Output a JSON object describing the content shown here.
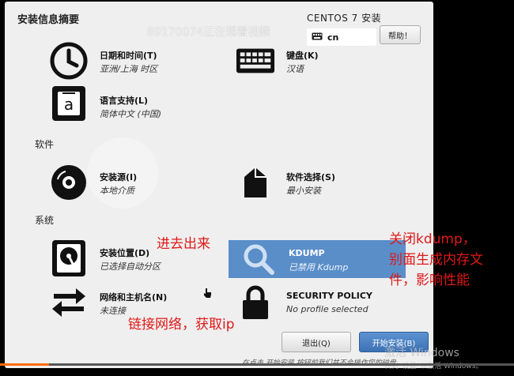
{
  "header": {
    "title": "安装信息摘要",
    "product": "CENTOS 7 安装",
    "keyboard_layout": "cn",
    "help_label": "帮助！"
  },
  "overlay": {
    "viewer_watermark": "89170074正在观看视频",
    "activate_windows_title": "激活 Windows",
    "activate_windows_sub": "转到“设置”以激活 Windows。"
  },
  "sections": {
    "software": "软件",
    "system": "系统"
  },
  "hubs": {
    "datetime": {
      "title": "日期和时间(T)",
      "status": "亚洲/上海 时区"
    },
    "keyboard": {
      "title": "键盘(K)",
      "status": "汉语"
    },
    "language": {
      "title": "语言支持(L)",
      "status": "简体中文 (中国)"
    },
    "source": {
      "title": "安装源(I)",
      "status": "本地介质"
    },
    "software_selection": {
      "title": "软件选择(S)",
      "status": "最小安装"
    },
    "destination": {
      "title": "安装位置(D)",
      "status": "已选择自动分区"
    },
    "kdump": {
      "title": "KDUMP",
      "status": "已禁用 Kdump"
    },
    "network": {
      "title": "网络和主机名(N)",
      "status": "未连接"
    },
    "security": {
      "title": "SECURITY POLICY",
      "status": "No profile selected"
    }
  },
  "buttons": {
    "quit": "退出(Q)",
    "begin": "开始安装(B)"
  },
  "footer": {
    "warning": "在点击 开始安装 按钮前我们并不会操作您的磁盘。"
  },
  "annotations": {
    "enter_exit": "进去出来",
    "kdump_note_line1": "关闭kdump，",
    "kdump_note_line2": "别面生成内存文",
    "kdump_note_line3": "件，影响性能",
    "network_note": "链接网络，获取ip"
  },
  "video": {
    "progress": 0.095
  },
  "colors": {
    "selected_hub": "#5a8ec9",
    "primary_button": "#3c71b3",
    "annotation_red": "#e01818",
    "progress": "#ff6a00"
  }
}
